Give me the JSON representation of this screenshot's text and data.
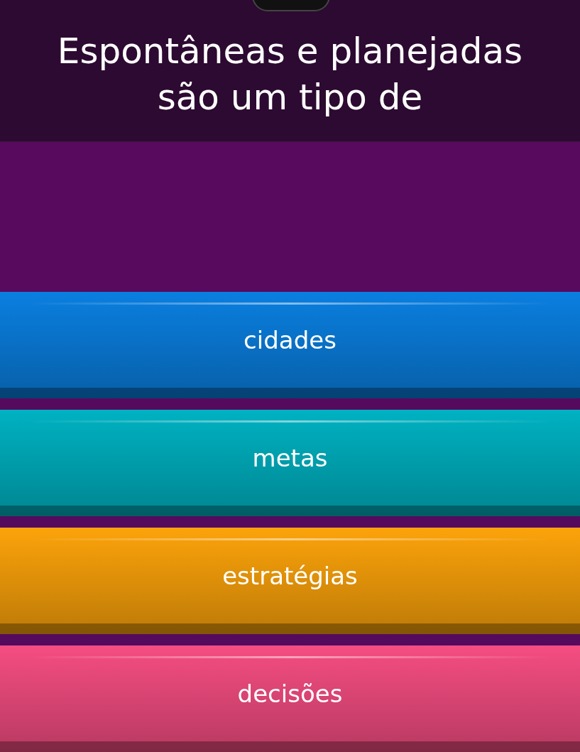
{
  "question": "Espontâneas e planejadas são um tipo de",
  "options": [
    {
      "label": "cidades",
      "color": "#0a7fe0"
    },
    {
      "label": "metas",
      "color": "#00b2c2"
    },
    {
      "label": "estratégias",
      "color": "#fca30a"
    },
    {
      "label": "decisões",
      "color": "#f54d82"
    }
  ]
}
